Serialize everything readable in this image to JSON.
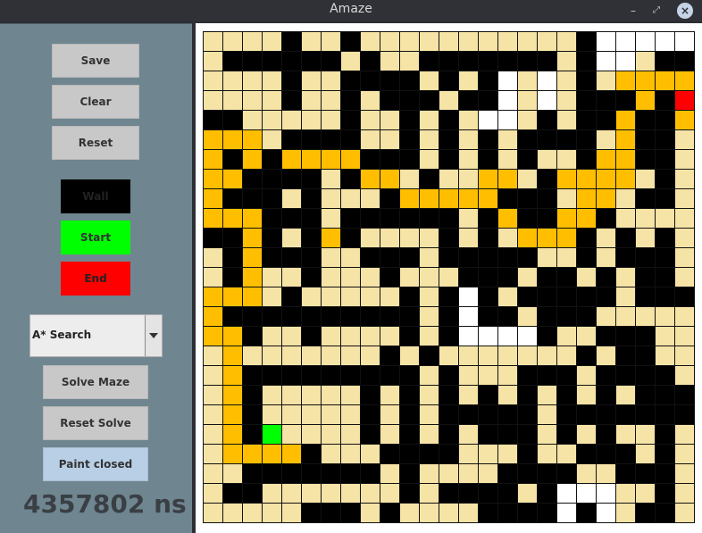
{
  "window": {
    "title": "Amaze",
    "controls": {
      "minimize": "–",
      "maximize": "⤢",
      "close": "×"
    }
  },
  "sidebar": {
    "save_label": "Save",
    "clear_label": "Clear",
    "reset_label": "Reset",
    "wall_label": "Wall",
    "start_label": "Start",
    "end_label": "End",
    "algorithm_selected": "A* Search",
    "solve_label": "Solve Maze",
    "reset_solve_label": "Reset Solve",
    "paint_closed_label": "Paint closed",
    "time_readout": "4357802 ns"
  },
  "colors": {
    "empty": "#f6e3a6",
    "wall": "#000000",
    "path": "#ffbf00",
    "unvisited": "#ffffff",
    "start": "#00ff00",
    "end": "#ff0000",
    "panel": "#6f8690"
  },
  "maze": {
    "rows": 25,
    "cols": 25,
    "legend": {
      "0": "empty",
      "1": "wall",
      "2": "path",
      "3": "unvisited",
      "4": "start",
      "5": "end"
    },
    "grid": [
      "0000100100000000000133333",
      "0111111010011111110133011",
      "0000100111101013030102222",
      "0000100101110113030111215",
      "1100000100101033010112112",
      "2220111100101010111102110",
      "2121222211101010100122110",
      "2211110122010022012222010",
      "2111010001222221110220110",
      "2221110111111012112210000",
      "1121012100001010222101010",
      "0121110011101111100101110",
      "0120010001000111011010110",
      "2220100000101310111110111",
      "2111111111101311011100000",
      "2210010000101333310011100",
      "0200000001010000000101100",
      "0211111111101000111011110",
      "0210000010101010101010111",
      "0210000010101111101111111",
      "0214000010101011101010010",
      "0222210001111000100111010",
      "0011111110100001111001110",
      "0110000000101111013330010",
      "0000011101000011113130110"
    ]
  }
}
